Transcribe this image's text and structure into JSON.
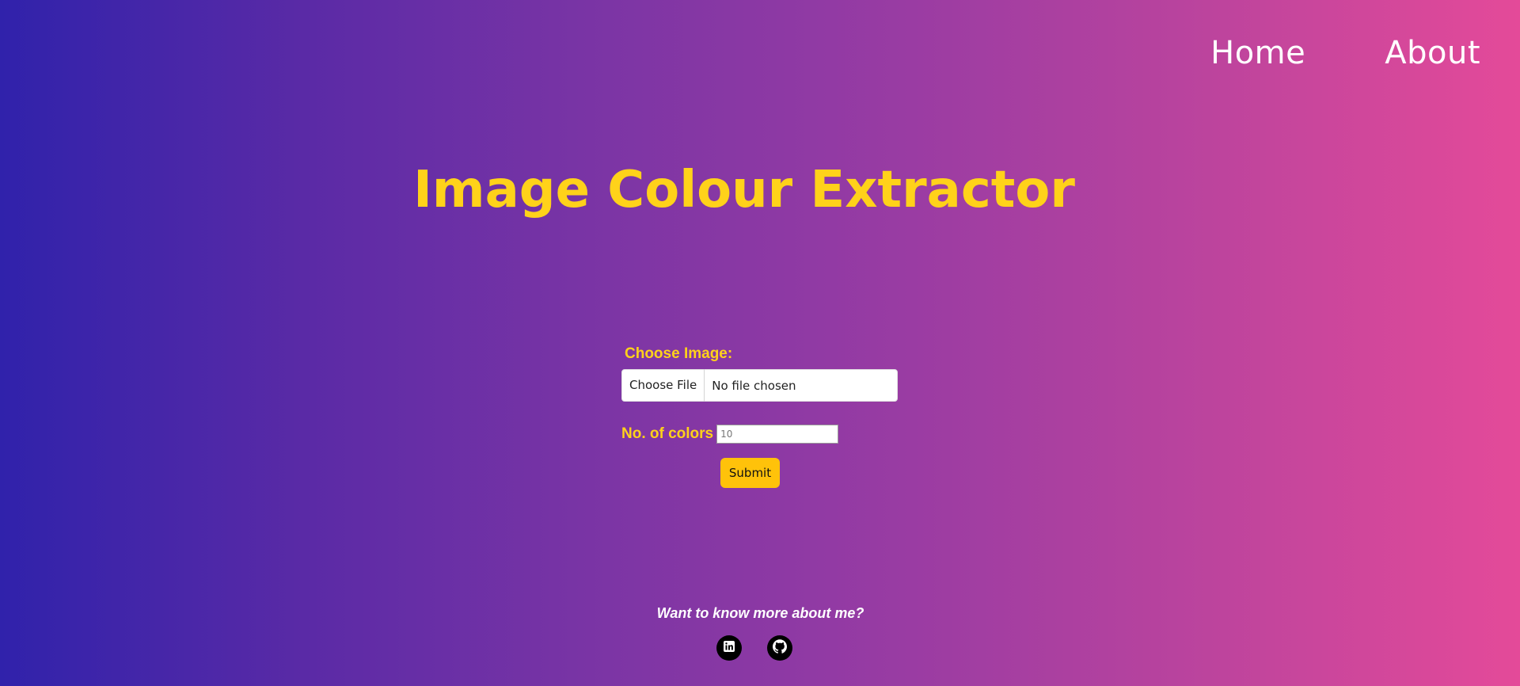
{
  "nav": {
    "home": "Home",
    "about": "About"
  },
  "title": "Image Colour Extractor",
  "form": {
    "choose_image_label": "Choose Image:",
    "choose_file_button": "Choose File",
    "file_status": "No file chosen",
    "colors_label": "No. of colors",
    "colors_value": "10",
    "submit_label": "Submit"
  },
  "footer": {
    "prompt": "Want to know more about me?",
    "socials": [
      {
        "name": "linkedin-icon"
      },
      {
        "name": "github-icon"
      }
    ]
  },
  "colors": {
    "accent": "#ffd21a",
    "button": "#ffc20a",
    "gradient_start": "#3022ab",
    "gradient_end": "#e44a99"
  }
}
